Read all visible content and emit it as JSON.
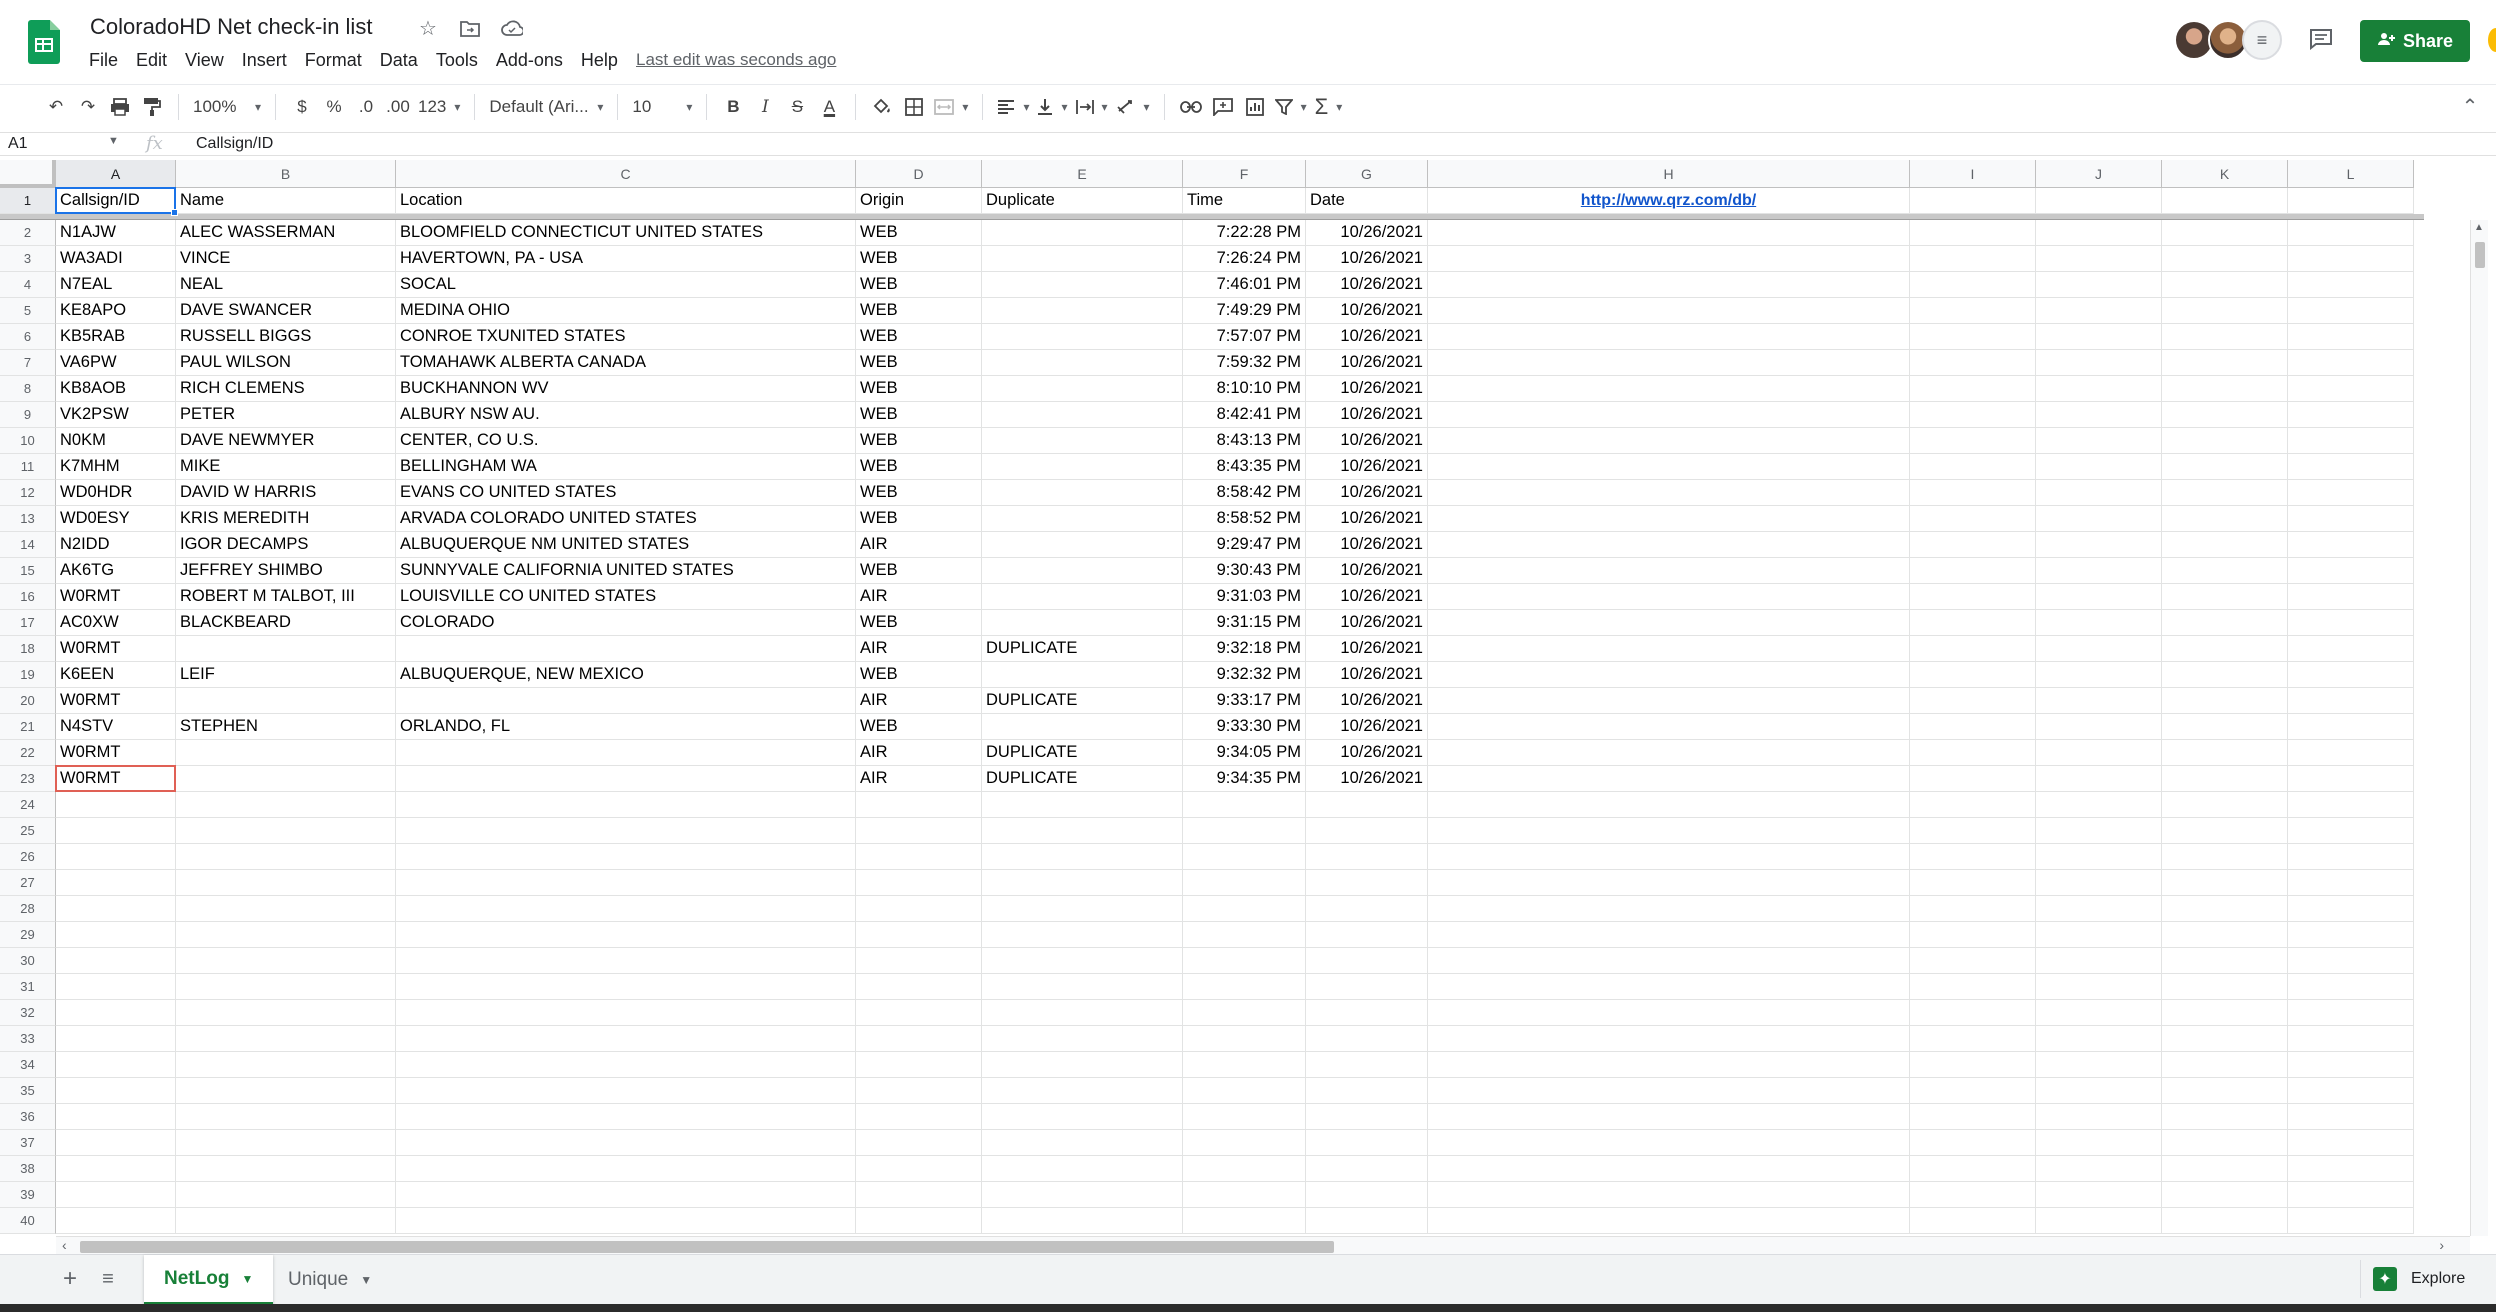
{
  "app": {
    "title": "ColoradoHD Net check-in list",
    "last_edit": "Last edit was seconds ago",
    "share_label": "Share",
    "brand_color": "#188038"
  },
  "menu": [
    "File",
    "Edit",
    "View",
    "Insert",
    "Format",
    "Data",
    "Tools",
    "Add-ons",
    "Help"
  ],
  "toolbar": {
    "zoom": "100%",
    "currency": "$",
    "percent": "%",
    "decrease_decimal": ".0",
    "increase_decimal": ".00",
    "more_formats": "123",
    "font": "Default (Ari...",
    "font_size": "10",
    "bold": "B",
    "italic": "I",
    "strikethrough": "S",
    "text_color": "A"
  },
  "formula_bar": {
    "cell_ref": "A1",
    "fx": "fx",
    "value": "Callsign/ID"
  },
  "columns": [
    "A",
    "B",
    "C",
    "D",
    "E",
    "F",
    "G",
    "H",
    "I",
    "J",
    "K",
    "L"
  ],
  "header_row": [
    "Callsign/ID",
    "Name",
    "Location",
    "Origin",
    "Duplicate",
    "Time",
    "Date",
    "http://www.qrz.com/db/"
  ],
  "rows": [
    [
      "N1AJW",
      "ALEC WASSERMAN",
      "BLOOMFIELD CONNECTICUT UNITED STATES",
      "WEB",
      "",
      "7:22:28 PM",
      "10/26/2021"
    ],
    [
      "WA3ADI",
      "VINCE",
      "HAVERTOWN, PA - USA",
      "WEB",
      "",
      "7:26:24 PM",
      "10/26/2021"
    ],
    [
      "N7EAL",
      "NEAL",
      "SOCAL",
      "WEB",
      "",
      "7:46:01 PM",
      "10/26/2021"
    ],
    [
      "KE8APO",
      "DAVE SWANCER",
      "MEDINA OHIO",
      "WEB",
      "",
      "7:49:29 PM",
      "10/26/2021"
    ],
    [
      "KB5RAB",
      "RUSSELL BIGGS",
      "CONROE TXUNITED STATES",
      "WEB",
      "",
      "7:57:07 PM",
      "10/26/2021"
    ],
    [
      "VA6PW",
      "PAUL WILSON",
      "TOMAHAWK ALBERTA CANADA",
      "WEB",
      "",
      "7:59:32 PM",
      "10/26/2021"
    ],
    [
      "KB8AOB",
      "RICH CLEMENS",
      "BUCKHANNON WV",
      "WEB",
      "",
      "8:10:10 PM",
      "10/26/2021"
    ],
    [
      "VK2PSW",
      "PETER",
      "ALBURY NSW AU.",
      "WEB",
      "",
      "8:42:41 PM",
      "10/26/2021"
    ],
    [
      "N0KM",
      "DAVE NEWMYER",
      "CENTER, CO U.S.",
      "WEB",
      "",
      "8:43:13 PM",
      "10/26/2021"
    ],
    [
      "K7MHM",
      "MIKE",
      "BELLINGHAM WA",
      "WEB",
      "",
      "8:43:35 PM",
      "10/26/2021"
    ],
    [
      "WD0HDR",
      "DAVID W HARRIS",
      "EVANS CO UNITED STATES",
      "WEB",
      "",
      "8:58:42 PM",
      "10/26/2021"
    ],
    [
      "WD0ESY",
      "KRIS MEREDITH",
      "ARVADA COLORADO UNITED STATES",
      "WEB",
      "",
      "8:58:52 PM",
      "10/26/2021"
    ],
    [
      "N2IDD",
      "IGOR DECAMPS",
      "ALBUQUERQUE NM UNITED STATES",
      "AIR",
      "",
      "9:29:47 PM",
      "10/26/2021"
    ],
    [
      "AK6TG",
      "JEFFREY SHIMBO",
      "SUNNYVALE CALIFORNIA UNITED STATES",
      "WEB",
      "",
      "9:30:43 PM",
      "10/26/2021"
    ],
    [
      "W0RMT",
      "ROBERT M TALBOT, III",
      "LOUISVILLE CO UNITED STATES",
      "AIR",
      "",
      "9:31:03 PM",
      "10/26/2021"
    ],
    [
      "AC0XW",
      "BLACKBEARD",
      "COLORADO",
      "WEB",
      "",
      "9:31:15 PM",
      "10/26/2021"
    ],
    [
      "W0RMT",
      "",
      "",
      "AIR",
      "DUPLICATE",
      "9:32:18 PM",
      "10/26/2021"
    ],
    [
      "K6EEN",
      "LEIF",
      "ALBUQUERQUE, NEW MEXICO",
      "WEB",
      "",
      "9:32:32 PM",
      "10/26/2021"
    ],
    [
      "W0RMT",
      "",
      "",
      "AIR",
      "DUPLICATE",
      "9:33:17 PM",
      "10/26/2021"
    ],
    [
      "N4STV",
      "STEPHEN",
      "ORLANDO, FL",
      "WEB",
      "",
      "9:33:30 PM",
      "10/26/2021"
    ],
    [
      "W0RMT",
      "",
      "",
      "AIR",
      "DUPLICATE",
      "9:34:05 PM",
      "10/26/2021"
    ],
    [
      "W0RMT",
      "",
      "",
      "AIR",
      "DUPLICATE",
      "9:34:35 PM",
      "10/26/2021"
    ]
  ],
  "row_numbers": [
    "1",
    "2",
    "3",
    "4",
    "5",
    "6",
    "7",
    "8",
    "9",
    "10",
    "11",
    "12",
    "13",
    "14",
    "15",
    "16",
    "17",
    "18",
    "19",
    "20",
    "21",
    "22",
    "23",
    "24",
    "25",
    "26",
    "27",
    "28",
    "29",
    "30",
    "31",
    "32",
    "33",
    "34",
    "35",
    "36",
    "37",
    "38",
    "39",
    "40"
  ],
  "sheets": [
    {
      "name": "NetLog",
      "active": true
    },
    {
      "name": "Unique",
      "active": false
    }
  ],
  "explore_label": "Explore",
  "icons": {
    "star": "star-icon",
    "move": "folder-move-icon",
    "cloud": "cloud-status-icon",
    "comments": "comments-icon",
    "share": "person-add-icon"
  }
}
